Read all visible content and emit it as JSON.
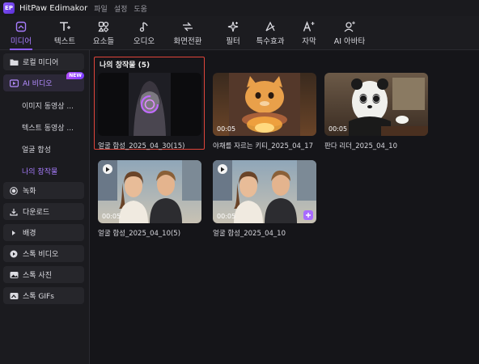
{
  "app": {
    "title": "HitPaw Edimakor",
    "logo_text": "EP",
    "menus": [
      "파일",
      "설정",
      "도움"
    ]
  },
  "toolbar": {
    "items": [
      {
        "label": "미디어",
        "icon": "media-icon",
        "active": true
      },
      {
        "label": "텍스트",
        "icon": "text-icon"
      },
      {
        "label": "요소들",
        "icon": "elements-icon"
      },
      {
        "label": "오디오",
        "icon": "audio-icon"
      },
      {
        "label": "화면전환",
        "icon": "transition-icon"
      },
      {
        "label": "필터",
        "icon": "filter-icon"
      },
      {
        "label": "특수효과",
        "icon": "effects-icon"
      },
      {
        "label": "자막",
        "icon": "subtitle-icon"
      },
      {
        "label": "AI 아바타",
        "icon": "ai-avatar-icon"
      }
    ]
  },
  "sidebar": {
    "items": [
      {
        "label": "로컬 미디어",
        "icon": "folder-icon"
      },
      {
        "label": "AI 비디오",
        "icon": "ai-video-icon",
        "badge": "NEW",
        "active": true
      },
      {
        "label": "녹화",
        "icon": "record-icon"
      },
      {
        "label": "다운로드",
        "icon": "download-icon"
      },
      {
        "label": "배경",
        "icon": "caret-right-icon"
      },
      {
        "label": "스톡 비디오",
        "icon": "stock-video-icon"
      },
      {
        "label": "스톡 사진",
        "icon": "stock-photo-icon"
      },
      {
        "label": "스톡 GIFs",
        "icon": "gif-icon"
      }
    ],
    "subitems": [
      {
        "label": "이미지 동영상 ..."
      },
      {
        "label": "텍스트 동영상 ..."
      },
      {
        "label": "얼굴 합성"
      },
      {
        "label": "나의 창작물",
        "active": true
      }
    ]
  },
  "main": {
    "folder_title": "나의 창작물 (5)",
    "cards": [
      {
        "caption": "얼굴 합성_2025_04_30(15)",
        "duration": "",
        "selected": true,
        "loading": true
      },
      {
        "caption": "야채를 자르는 키티_2025_04_17",
        "duration": "00:05"
      },
      {
        "caption": "판다 리더_2025_04_10",
        "duration": "00:05"
      },
      {
        "caption": "얼굴 합성_2025_04_10(5)",
        "duration": "00:05",
        "play": true
      },
      {
        "caption": "얼굴 합성_2025_04_10",
        "duration": "00:05",
        "play": true,
        "add": true
      }
    ]
  },
  "colors": {
    "accent": "#8c5cff",
    "selection": "#e0453b",
    "background": "#151519"
  }
}
